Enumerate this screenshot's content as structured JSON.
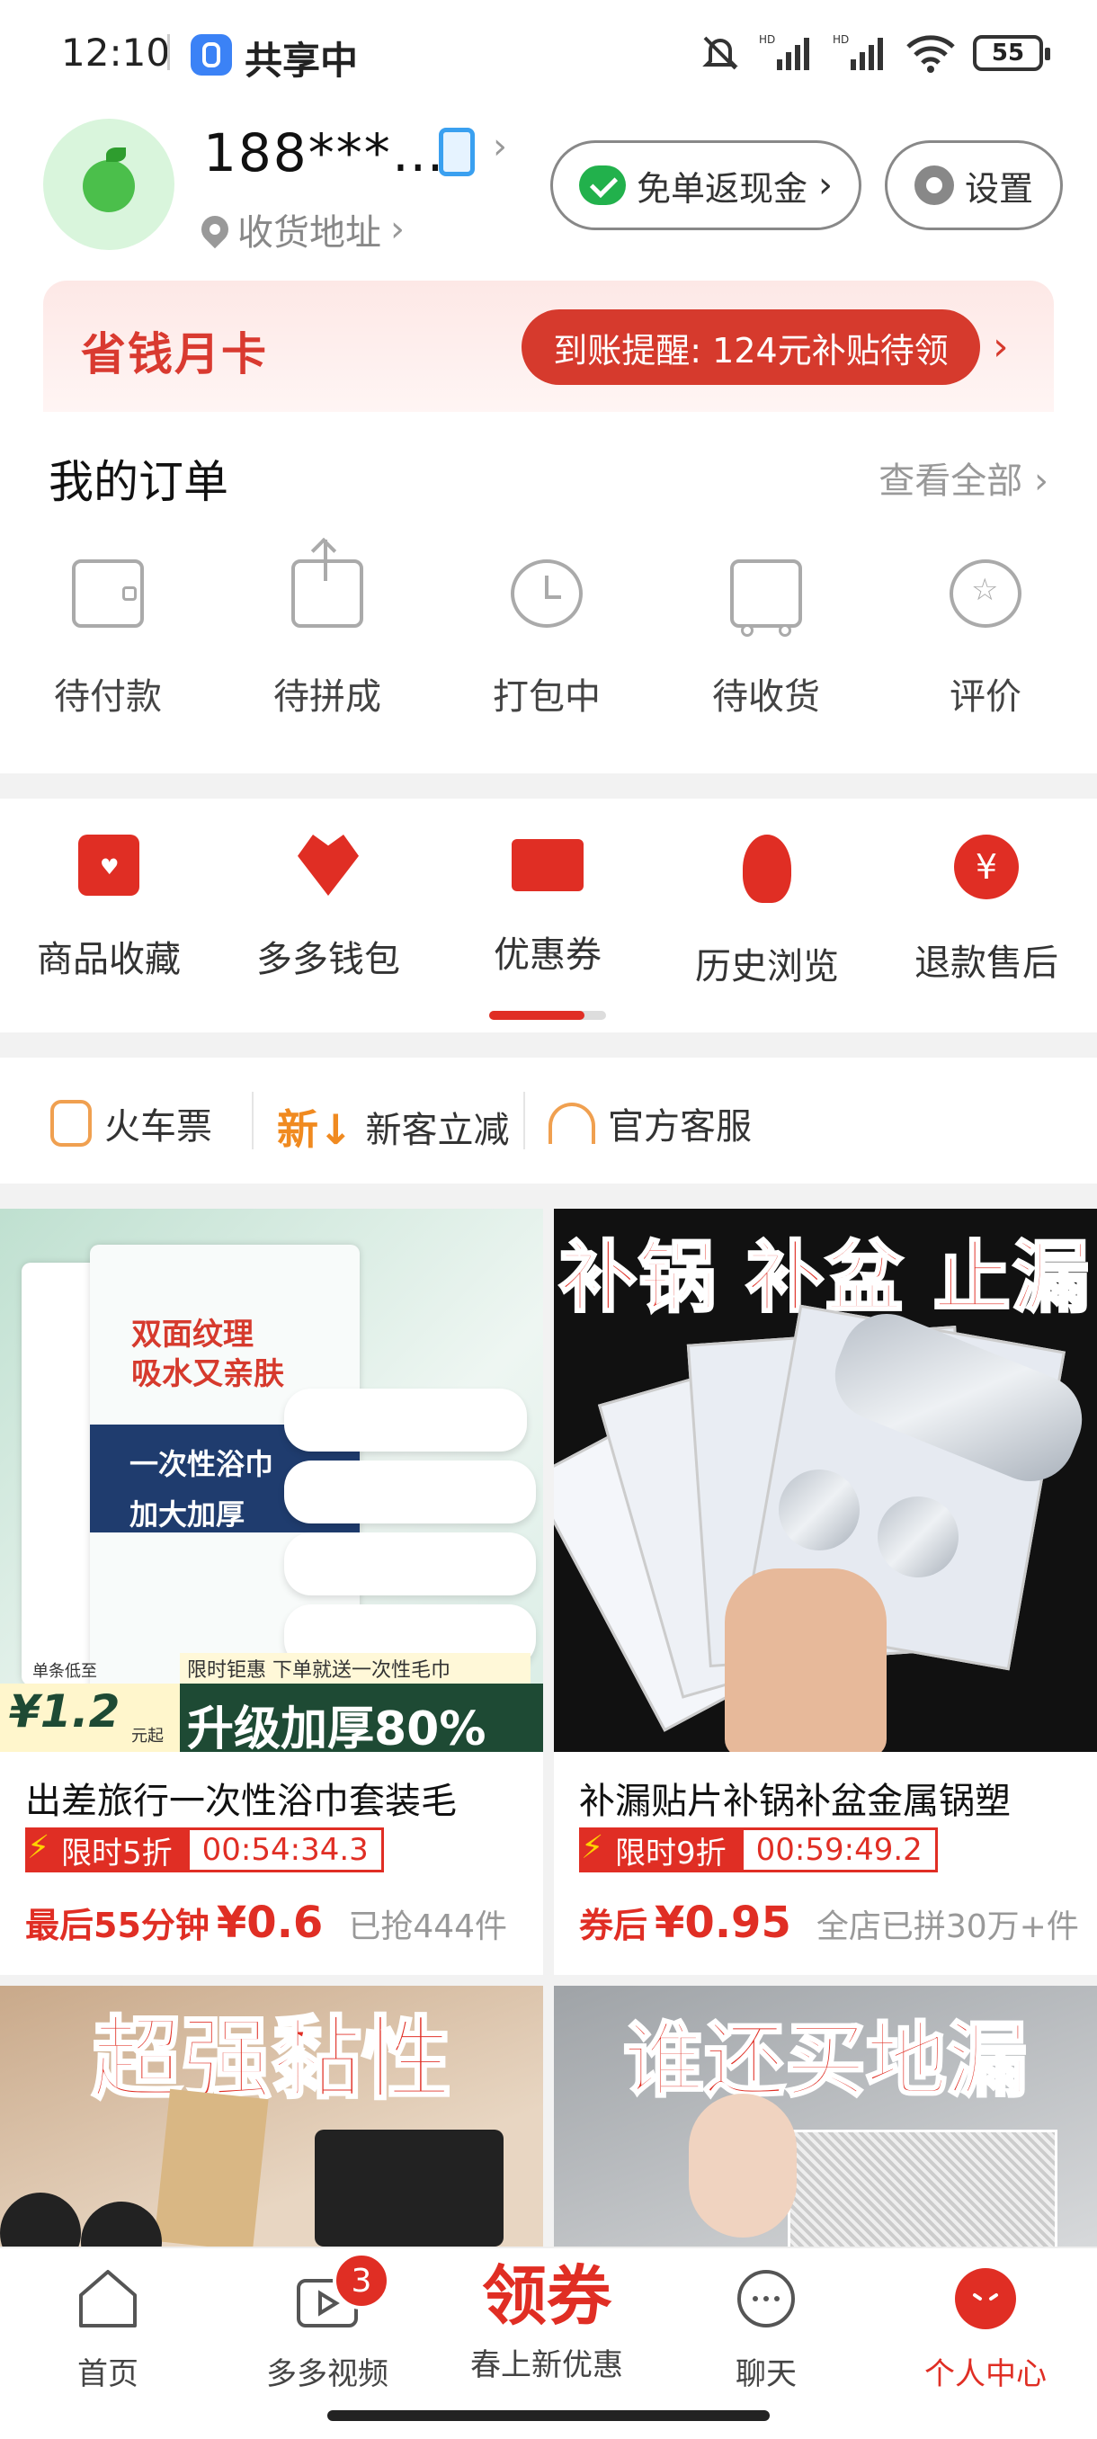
{
  "status_bar": {
    "time": "12:10",
    "share_label": "共享中",
    "battery": "55"
  },
  "profile": {
    "username": "188***…",
    "address_label": "收货地址"
  },
  "buttons": {
    "cashback": "免单返现金",
    "settings": "设置"
  },
  "monthly_card": {
    "title": "省钱月卡",
    "reminder": "到账提醒: 124元补贴待领"
  },
  "orders": {
    "title": "我的订单",
    "view_all": "查看全部",
    "items": [
      {
        "label": "待付款",
        "icon": "wallet-icon"
      },
      {
        "label": "待拼成",
        "icon": "share-box-icon"
      },
      {
        "label": "打包中",
        "icon": "clock-icon"
      },
      {
        "label": "待收货",
        "icon": "truck-icon"
      },
      {
        "label": "评价",
        "icon": "star-bubble-icon"
      }
    ]
  },
  "services": [
    {
      "label": "商品收藏",
      "icon": "favorites-bag-icon"
    },
    {
      "label": "多多钱包",
      "icon": "wallet-heart-icon"
    },
    {
      "label": "优惠券",
      "icon": "coupon-icon"
    },
    {
      "label": "历史浏览",
      "icon": "footprint-icon"
    },
    {
      "label": "退款售后",
      "icon": "refund-yen-icon"
    }
  ],
  "quick_links": [
    {
      "label": "火车票",
      "icon": "train-icon"
    },
    {
      "label": "新客立减",
      "icon": "new-customer-icon"
    },
    {
      "label": "官方客服",
      "icon": "headset-icon"
    }
  ],
  "products": [
    {
      "image_text": {
        "line1": "双面纹理",
        "line2": "吸水又亲肤",
        "line3": "一次性浴巾",
        "line4": "加大加厚",
        "promo": "限时钜惠 下单就送一次性毛巾",
        "big": "升级加厚80%",
        "unit_label": "单条低至",
        "unit_price": "¥1.2",
        "unit_suffix": "元起"
      },
      "name": "出差旅行一次性浴巾套装毛",
      "flash_label": "限时5折",
      "countdown": "00:54:34.3",
      "price_label": "最后55分钟",
      "price": "¥0.6",
      "sold": "已抢444件"
    },
    {
      "image_text": {
        "banner": "补锅 补盆 止漏"
      },
      "name": "补漏贴片补锅补盆金属锅塑",
      "flash_label": "限时9折",
      "countdown": "00:59:49.2",
      "price_label": "券后",
      "price": "¥0.95",
      "sold": "全店已拼30万+件"
    },
    {
      "image_text": {
        "banner": "超强黏性"
      }
    },
    {
      "image_text": {
        "banner": "谁还买地漏"
      }
    }
  ],
  "tabbar": {
    "items": [
      {
        "label": "首页"
      },
      {
        "label": "多多视频",
        "badge": "3"
      },
      {
        "label": "春上新优惠",
        "headline": "领券"
      },
      {
        "label": "聊天"
      },
      {
        "label": "个人中心"
      }
    ]
  },
  "colors": {
    "brand_red": "#e02e24",
    "card_red": "#d63a2d"
  }
}
